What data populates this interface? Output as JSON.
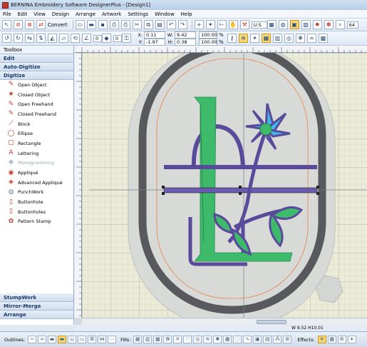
{
  "window": {
    "title": "BERNINA Embroidery Software DesignerPlus - [Design1]"
  },
  "menu": [
    "File",
    "Edit",
    "View",
    "Design",
    "Arrange",
    "Artwork",
    "Settings",
    "Window",
    "Help"
  ],
  "toolbar": {
    "convert_label": "Convert",
    "angle_value": "0",
    "color_value": "0",
    "x_label": "X:",
    "x_value": "0.11",
    "y_label": "Y:",
    "y_value": "-1.97",
    "w_label": "W:",
    "w_value": "9.42",
    "h_label": "H:",
    "h_value": "0.38",
    "scale_w_value": "100.00",
    "scale_h_value": "100.00",
    "scale_unit": "%",
    "region_value": "U.S.",
    "zoom_value": "64"
  },
  "sidebar": {
    "toolbox_label": "Toolbox",
    "sections_top": [
      "Edit",
      "Auto-Digitize",
      "Digitize"
    ],
    "tools": [
      {
        "label": "Open Object",
        "icon": "open-object-icon",
        "glyph": "✎",
        "color": "#c0392b",
        "disabled": false
      },
      {
        "label": "Closed Object",
        "icon": "closed-object-icon",
        "glyph": "★",
        "color": "#c0392b",
        "disabled": false
      },
      {
        "label": "Open Freehand",
        "icon": "open-freehand-icon",
        "glyph": "✎",
        "color": "#c0392b",
        "disabled": false
      },
      {
        "label": "Closed Freehand",
        "icon": "closed-freehand-icon",
        "glyph": "✎",
        "color": "#c0392b",
        "disabled": false
      },
      {
        "label": "Block",
        "icon": "block-icon",
        "glyph": "⟋",
        "color": "#c0392b",
        "disabled": false
      },
      {
        "label": "Ellipse",
        "icon": "ellipse-icon",
        "glyph": "◯",
        "color": "#c0392b",
        "disabled": false
      },
      {
        "label": "Rectangle",
        "icon": "rectangle-icon",
        "glyph": "▢",
        "color": "#c0392b",
        "disabled": false
      },
      {
        "label": "Lettering",
        "icon": "lettering-icon",
        "glyph": "A",
        "color": "#c0392b",
        "disabled": false
      },
      {
        "label": "Monogramming",
        "icon": "monogramming-icon",
        "glyph": "❖",
        "color": "#9aa5b3",
        "disabled": true
      },
      {
        "label": "Appliqué",
        "icon": "applique-icon",
        "glyph": "◉",
        "color": "#c0392b",
        "disabled": false
      },
      {
        "label": "Advanced Appliqué",
        "icon": "advanced-applique-icon",
        "glyph": "◈",
        "color": "#c0392b",
        "disabled": false
      },
      {
        "label": "PunchWork",
        "icon": "punchwork-icon",
        "glyph": "◍",
        "color": "#7a8799",
        "disabled": false
      },
      {
        "label": "Buttonhole",
        "icon": "buttonhole-icon",
        "glyph": "▯",
        "color": "#c0392b",
        "disabled": false
      },
      {
        "label": "Buttonholes",
        "icon": "buttonholes-icon",
        "glyph": "▯",
        "color": "#c0392b",
        "disabled": false
      },
      {
        "label": "Pattern Stamp",
        "icon": "pattern-stamp-icon",
        "glyph": "✿",
        "color": "#c0392b",
        "disabled": false
      }
    ],
    "sections_bottom": [
      "StumpWork",
      "Mirror-Merge",
      "Arrange"
    ]
  },
  "status": {
    "size_readout": "W 9.52 H10.01"
  },
  "bottom": {
    "outlines_label": "Outlines:",
    "fills_label": "Fills:",
    "effects_label": "Effects:"
  },
  "colors": {
    "accent": "#f7d774",
    "hoop_outer": "#58595c",
    "letter_green": "#3dbb6b",
    "stem_purple": "#5a4a9c",
    "flower_blue": "#41b8e8",
    "hoop_inner_line": "#e8824a"
  }
}
